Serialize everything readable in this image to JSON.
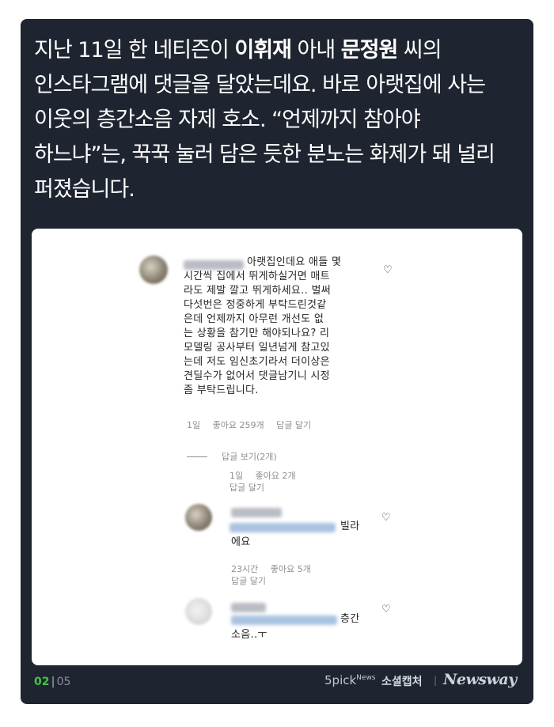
{
  "headline": {
    "line1_a": "지난 11일 한 네티즌이 ",
    "line1_b": "이휘재",
    "line1_c": " 아내 ",
    "line1_d": "문정원",
    "line1_e": " 씨의",
    "line2": "인스타그램에 댓글을 달았는데요. 바로 아랫집에 사는",
    "line3": "이웃의 층간소음 자제 호소. “언제까지 참아야",
    "line4": "하느냐”는, 꾹꾹 눌러 담은 듯한 분노는 화제가 돼 널리",
    "line5": "퍼졌습니다."
  },
  "comment": {
    "lines": [
      "아랫집인데요 애들 몇",
      "시간씩 집에서 뛰게하실거면 매트",
      "라도 제발 깔고 뛰게하세요.. 벌써",
      "다섯번은 정중하게 부탁드린것같",
      "은데 언제까지 아무런 개선도 없",
      "는 상황을 참기만 해야되나요? 리",
      "모델링 공사부터 일년넘게 참고있",
      "는데 저도 임신초기라서 더이상은",
      "견딜수가 없어서 댓글남기니 시정",
      "좀 부탁드립니다."
    ],
    "time": "1일",
    "likes": "좋아요 259개",
    "reply": "답글 달기",
    "view_replies": "답글 보기(2개)"
  },
  "replies": [
    {
      "time": "1일",
      "likes": "좋아요 2개",
      "reply": "답글 달기"
    },
    {
      "text_end": "빌라",
      "text_line2": "에요",
      "time": "23시간",
      "likes": "좋아요 5개",
      "reply": "답글 달기"
    },
    {
      "text_end": "층간",
      "text_line2": "소음..ㅜ"
    }
  ],
  "footer": {
    "page_current": "02",
    "page_sep": "|",
    "page_total": "05",
    "brand_5pick": "5pick",
    "brand_news": "News",
    "brand_capture": "소셜캡처",
    "brand_sep": "|",
    "brand_newsway": "Newsway"
  },
  "colors": {
    "card_bg": "#1f2530",
    "accent_green": "#45c443"
  },
  "icons": {
    "like": "heart-outline-icon"
  }
}
